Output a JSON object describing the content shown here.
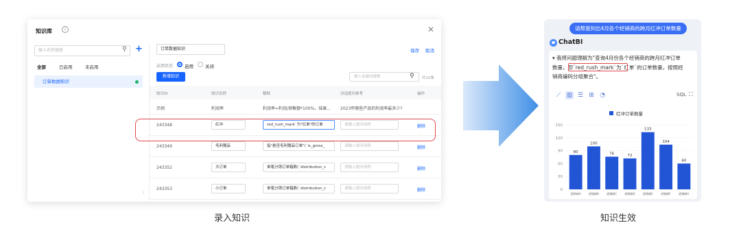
{
  "knowledge_base": {
    "title": "知识库",
    "info_icon": "info-icon",
    "close_icon": "close-icon",
    "sidebar": {
      "search_placeholder": "输入名称搜索",
      "filter_tabs": [
        "全部",
        "已启用",
        "未启用"
      ],
      "items": [
        {
          "label": "订单数据知识",
          "status": "enabled"
        }
      ]
    },
    "main": {
      "name_value": "订单数据知识",
      "save_label": "保存",
      "cancel_label": "取消",
      "status_label": "启用状态",
      "radio_on_label": "启用",
      "radio_off_label": "关闭",
      "new_button_label": "新增知识",
      "keyword_placeholder": "输入关键词搜索",
      "total_label": "共32条",
      "table": {
        "columns": [
          "知识ID",
          "知识名称",
          "解释",
          "对话提问参考",
          "操作"
        ],
        "example_row": [
          "示例",
          "利润率",
          "利润率=利润/销售额*100%，结果...",
          "2023年哪些产品的利润率最多少?"
        ],
        "rows": [
          {
            "id": "243348",
            "name": "红冲",
            "explain": "red_rush_mark`为\"红单\"的订单",
            "question_placeholder": "请输入提问用例",
            "action": "删除"
          },
          {
            "id": "243349",
            "name": "毛利赠品",
            "explain": "指\"是否毛利赠品订单\"(`is_gross_",
            "question_placeholder": "请输入提问用例",
            "action": "删除"
          },
          {
            "id": "243352",
            "name": "大订单",
            "explain": "单笔分销订单箱数(`distribution_c",
            "question_placeholder": "请输入提问用例",
            "action": "删除"
          },
          {
            "id": "243353",
            "name": "小订单",
            "explain": "单笔分销订单箱数(`distribution_c",
            "question_placeholder": "请输入提问用例",
            "action": "删除"
          }
        ]
      }
    }
  },
  "captions": {
    "left": "录入知识",
    "right": "知识生效"
  },
  "chatbi": {
    "question": "请帮我列出4月各个经销商的跨月红冲订单数量",
    "brand": "ChatBI",
    "answer_line1": "▾ 我将问题理解为\"查询4月份各个经销商的跨月红冲订单",
    "answer_line2": "数量，即`red_rush_mark`为`红单`的订单数量，按照经",
    "answer_line3": "销商编码分组聚合\"。",
    "toolbar_icons": [
      "line-chart-icon",
      "bar-chart-icon",
      "list-icon",
      "table-icon",
      "pie-chart-icon"
    ],
    "sql_label": "SQL",
    "expand_icon": "expand-icon",
    "accent_color": "#2255d6"
  },
  "chart_data": {
    "type": "bar",
    "title": "",
    "legend": [
      "红冲订单数量"
    ],
    "categories": [
      "经销商A",
      "经销商B",
      "经销商C",
      "经销商D",
      "经销商E",
      "经销商F",
      "经销商G"
    ],
    "series": [
      {
        "name": "红冲订单数量",
        "values": [
          80,
          100,
          76,
          72,
          133,
          104,
          60
        ]
      }
    ],
    "ylim": [
      0,
      150
    ],
    "yticks": [
      0,
      30,
      60,
      90,
      120,
      150
    ],
    "grid": true
  }
}
